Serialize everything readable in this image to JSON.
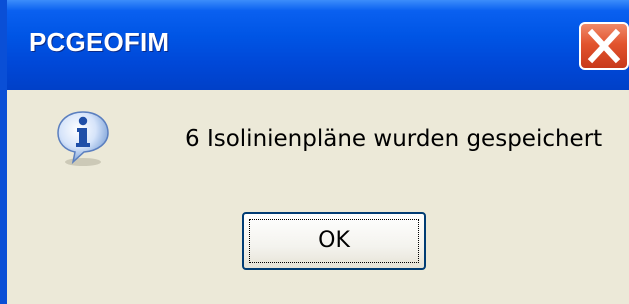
{
  "window": {
    "title": "PCGEOFIM"
  },
  "titlebar": {
    "close_icon": "close-icon"
  },
  "dialog": {
    "icon": "info-icon",
    "message": "6  Isolinienpläne wurden gespeichert",
    "ok_label": "OK"
  },
  "colors": {
    "titlebar": "#0055e5",
    "client_background": "#ece9d8",
    "close_button": "#e2542e",
    "button_border": "#003c74"
  }
}
